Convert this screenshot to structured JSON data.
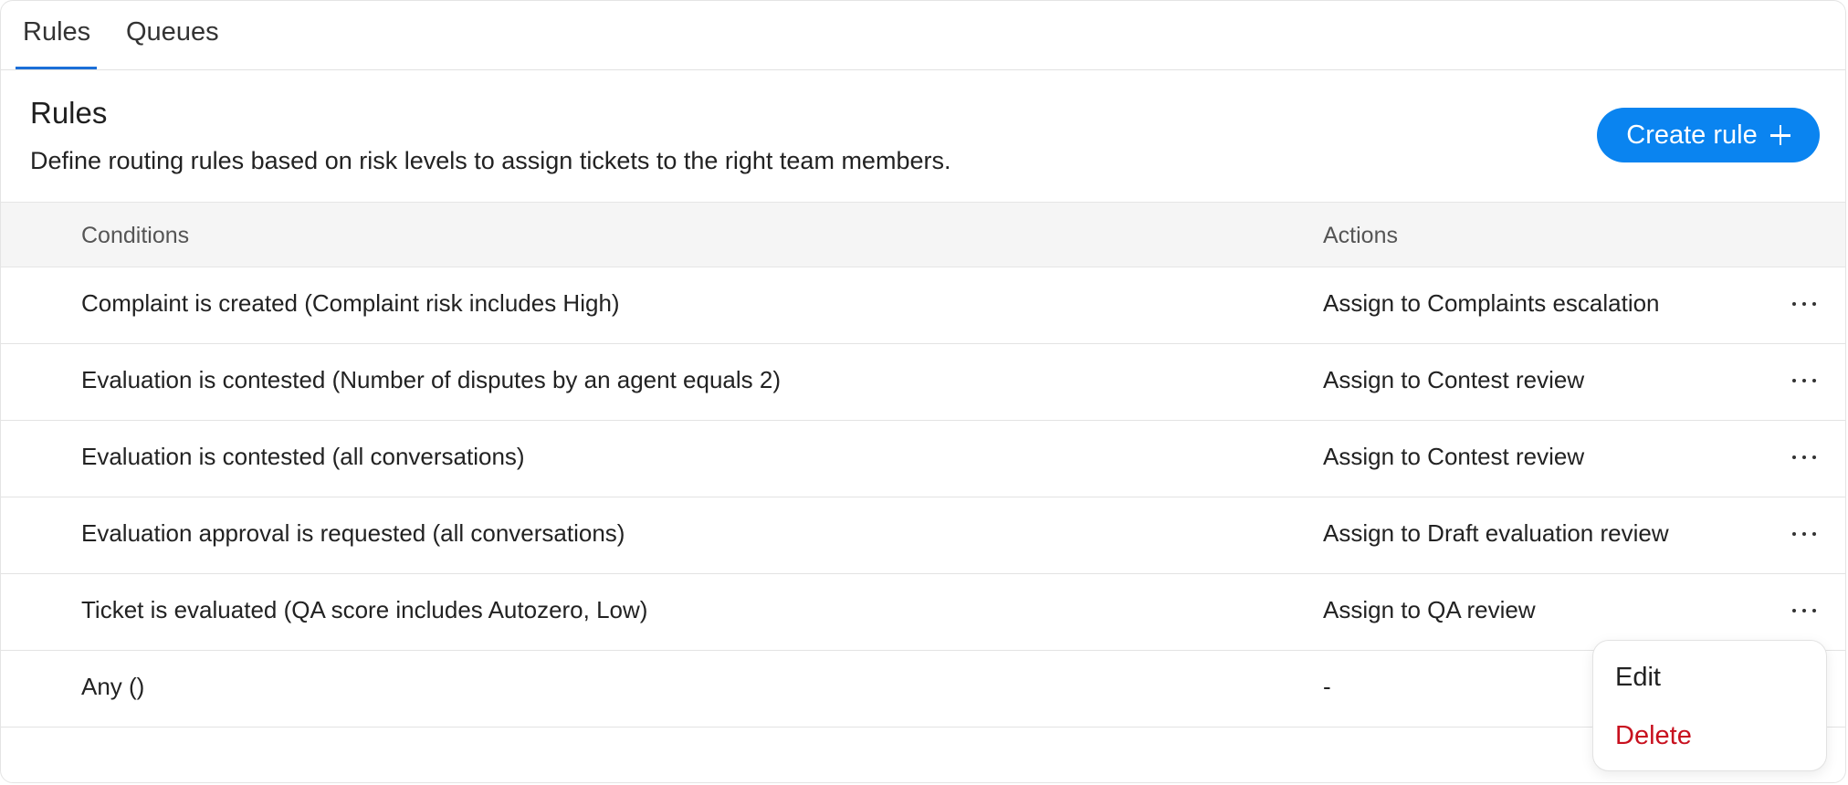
{
  "tabs": [
    {
      "label": "Rules",
      "active": true
    },
    {
      "label": "Queues",
      "active": false
    }
  ],
  "header": {
    "title": "Rules",
    "description": "Define routing rules based on risk levels to assign tickets to the right team members.",
    "create_label": "Create rule"
  },
  "table": {
    "columns": [
      "Conditions",
      "Actions"
    ],
    "rows": [
      {
        "condition": "Complaint is created (Complaint risk includes High)",
        "action": "Assign to Complaints escalation"
      },
      {
        "condition": "Evaluation is contested (Number of disputes by an agent equals 2)",
        "action": "Assign to Contest review"
      },
      {
        "condition": "Evaluation is contested (all conversations)",
        "action": "Assign to Contest review"
      },
      {
        "condition": "Evaluation approval is requested (all conversations)",
        "action": "Assign to Draft evaluation review"
      },
      {
        "condition": "Ticket is evaluated (QA score includes Autozero, Low)",
        "action": "Assign to QA review"
      },
      {
        "condition": "Any ()",
        "action": "-"
      }
    ]
  },
  "menu": {
    "edit_label": "Edit",
    "delete_label": "Delete"
  },
  "colors": {
    "accent": "#0a84f0",
    "tab_underline": "#1b6fd8",
    "danger": "#c8101e"
  },
  "icons": {
    "create": "plus-icon",
    "row_actions": "more-horizontal-icon"
  }
}
